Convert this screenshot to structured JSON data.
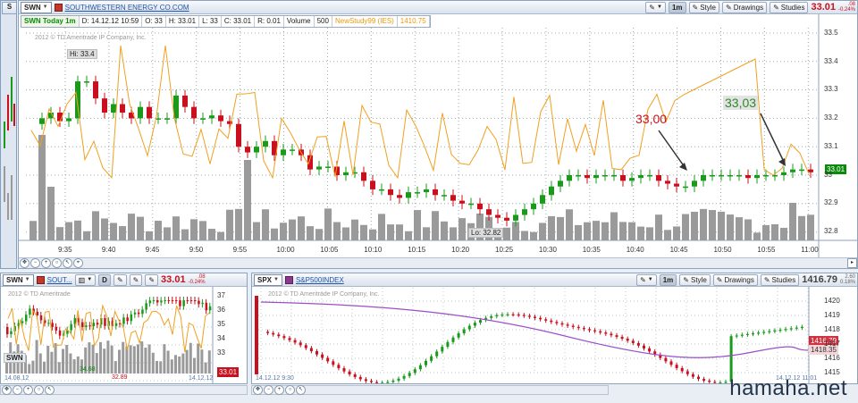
{
  "left_strip": {
    "symbol": "S"
  },
  "main": {
    "symbol": "SWN",
    "company_name": "SOUTHWESTERN ENERGY CO.COM",
    "toolbar": {
      "aggregation": "1m",
      "style": "Style",
      "drawings": "Drawings",
      "studies": "Studies",
      "last": "33.01",
      "change_abs": ".08",
      "change_pct": "-0.24%"
    },
    "study_bar": {
      "name": "SWN Today 1m",
      "date": "D: 14.12.12 10:59",
      "open": "O: 33",
      "high": "H: 33.01",
      "low": "L: 33",
      "close": "C: 33.01",
      "range": "R: 0.01",
      "volume_label": "Volume",
      "volume": "500",
      "study_name": "NewStudy99 (IES)",
      "study_value": "1410.75"
    },
    "copyright": "2012 © TD Ameritrade IP Company, Inc.",
    "hi_label": "Hi: 33.4",
    "lo_label": "Lo: 32.82",
    "price_tag": "33.01",
    "annotation_1": "33,00",
    "annotation_2": "33,03",
    "y_ticks": [
      "33.5",
      "33.4",
      "33.3",
      "33.2",
      "33.1",
      "33",
      "32.9",
      "32.8"
    ],
    "x_ticks": [
      "9:35",
      "9:40",
      "9:45",
      "9:50",
      "9:55",
      "10:00",
      "10:05",
      "10:10",
      "10:15",
      "10:20",
      "10:25",
      "10:30",
      "10:35",
      "10:40",
      "10:45",
      "10:50",
      "10:55",
      "11:00"
    ]
  },
  "bottom_left": {
    "symbol": "SWN",
    "company_short": "SOUT...",
    "aggregation": "D",
    "last": "33.01",
    "change_abs": ".08",
    "change_pct": "-0.24%",
    "copyright": "2012 © TD Ameritrade",
    "y_ticks": [
      "37",
      "36",
      "35",
      "34",
      "33"
    ],
    "price_tag": "33.01",
    "small_lbl_1": "34.68",
    "small_lbl_2": "32.89",
    "x_start": "14.08.12",
    "x_end": "14.12.12",
    "sub_symbol": "SWN"
  },
  "bottom_right": {
    "symbol": "SPX",
    "company_name": "S&P500INDEX",
    "toolbar": {
      "aggregation": "1m",
      "style": "Style",
      "drawings": "Drawings",
      "studies": "Studies",
      "last": "1416.79",
      "change_abs": "2.60",
      "change_pct": "0.18%"
    },
    "copyright": "2012 © TD Ameritrade IP Company, Inc.",
    "y_ticks": [
      "1420",
      "1419",
      "1418",
      "1417",
      "1416",
      "1415"
    ],
    "price_tag_1": "1416.79",
    "price_tag_2": "1418.35",
    "x_start": "14.12.12 9:30",
    "x_end": "14.12.12 11:01"
  },
  "watermark": "hamaha.net",
  "colors": {
    "up": "#1a9a1a",
    "down": "#c8101e",
    "study": "#f0a020",
    "volume": "#9a9a9a",
    "ma": "#9b4dca"
  }
}
